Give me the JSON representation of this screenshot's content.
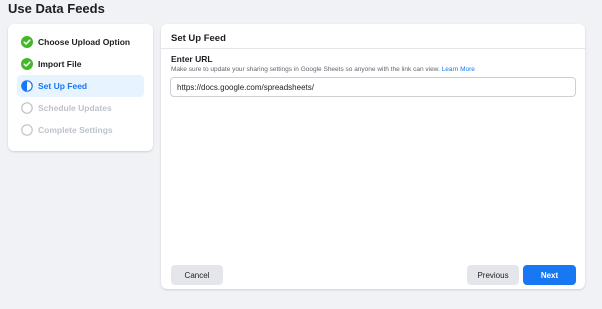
{
  "page": {
    "title": "Use Data Feeds"
  },
  "steps": [
    {
      "label": "Choose Upload Option",
      "state": "done"
    },
    {
      "label": "Import File",
      "state": "done"
    },
    {
      "label": "Set Up Feed",
      "state": "active"
    },
    {
      "label": "Schedule Updates",
      "state": "pending"
    },
    {
      "label": "Complete Settings",
      "state": "pending"
    }
  ],
  "main": {
    "section_title": "Set Up Feed",
    "field_label": "Enter URL",
    "help_text": "Make sure to update your sharing settings in Google Sheets so anyone with the link can view.",
    "help_link": "Learn More",
    "url_value": "https://docs.google.com/spreadsheets/"
  },
  "buttons": {
    "cancel": "Cancel",
    "previous": "Previous",
    "next": "Next"
  },
  "colors": {
    "accent": "#1877f2",
    "done": "#42b72a",
    "pending": "#bec3c9"
  }
}
